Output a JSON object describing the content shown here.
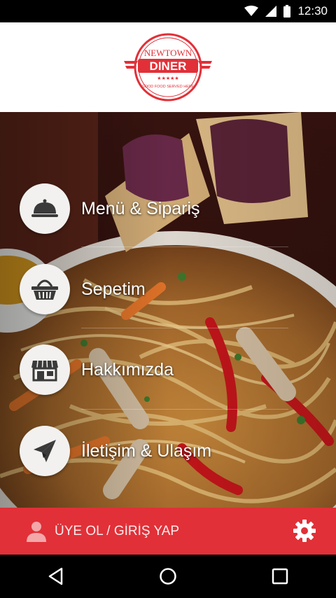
{
  "status_bar": {
    "time": "12:30",
    "icons": [
      "wifi-icon",
      "signal-icon",
      "battery-icon"
    ]
  },
  "header": {
    "logo": {
      "line1": "NEWTOWN",
      "line2": "DINER",
      "stars": "★★★★★",
      "tagline": "GOOD FOOD SERVED HERE"
    }
  },
  "menu": {
    "items": [
      {
        "label": "Menü & Sipariş",
        "icon": "cloche-icon"
      },
      {
        "label": "Sepetim",
        "icon": "basket-icon"
      },
      {
        "label": "Hakkımızda",
        "icon": "store-icon"
      },
      {
        "label": "İletişim & Ulaşım",
        "icon": "paper-plane-icon"
      }
    ]
  },
  "bottom_bar": {
    "login_label": "ÜYE OL / GİRİŞ YAP",
    "user_icon": "user-icon",
    "settings_icon": "gear-icon"
  },
  "nav_bar": {
    "buttons": [
      "back-icon",
      "home-icon",
      "recents-icon"
    ]
  },
  "colors": {
    "accent": "#e13038",
    "circle_bg": "#f2f1ef",
    "icon_dark": "#3a3a3a"
  }
}
